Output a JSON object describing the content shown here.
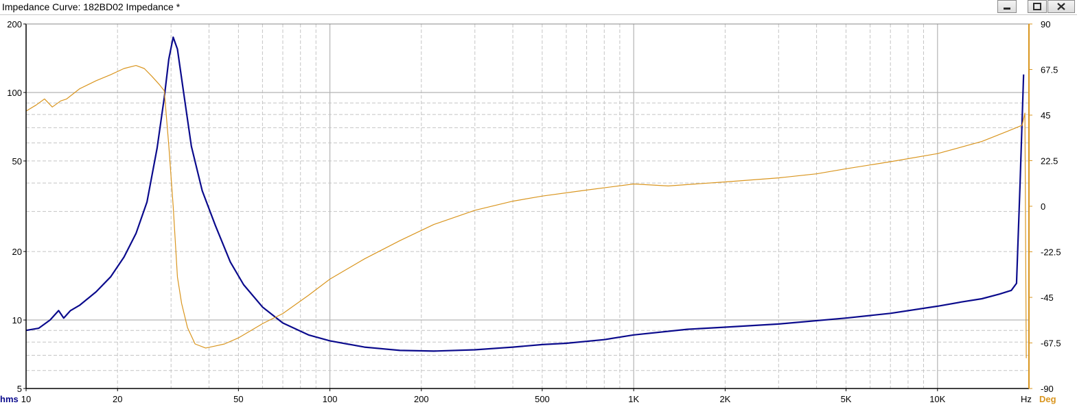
{
  "window": {
    "title": "Impedance Curve: 182BD02 Impedance *",
    "buttons": {
      "minimize": "minimize-icon",
      "maximize": "maximize-icon",
      "close": "close-icon"
    }
  },
  "colors": {
    "impedance": "#0a0a8c",
    "phase": "#d9951e",
    "grid_major": "#b4b4b4",
    "grid_minor": "#c4c4c4"
  },
  "chart_data": {
    "type": "line",
    "x_scale": "log",
    "y_scale": "log",
    "xlim": [
      10,
      20000
    ],
    "ylim": [
      5,
      200
    ],
    "y2lim": [
      -90,
      90
    ],
    "x_unit": "Hz",
    "y_unit": "hms",
    "y2_unit": "Deg",
    "x_ticks": [
      {
        "value": 10,
        "label": "10"
      },
      {
        "value": 20,
        "label": "20"
      },
      {
        "value": 50,
        "label": "50"
      },
      {
        "value": 100,
        "label": "100"
      },
      {
        "value": 200,
        "label": "200"
      },
      {
        "value": 500,
        "label": "500"
      },
      {
        "value": 1000,
        "label": "1K"
      },
      {
        "value": 2000,
        "label": "2K"
      },
      {
        "value": 5000,
        "label": "5K"
      },
      {
        "value": 10000,
        "label": "10K"
      }
    ],
    "y_ticks": [
      {
        "value": 5,
        "label": "5"
      },
      {
        "value": 10,
        "label": "10"
      },
      {
        "value": 20,
        "label": "20"
      },
      {
        "value": 50,
        "label": "50"
      },
      {
        "value": 100,
        "label": "100"
      },
      {
        "value": 200,
        "label": "200"
      }
    ],
    "y2_ticks": [
      {
        "value": -90,
        "label": "-90"
      },
      {
        "value": -67.5,
        "label": "-67.5"
      },
      {
        "value": -45,
        "label": "-45"
      },
      {
        "value": -22.5,
        "label": "-22.5"
      },
      {
        "value": 0,
        "label": "0"
      },
      {
        "value": 22.5,
        "label": "22.5"
      },
      {
        "value": 45,
        "label": "45"
      },
      {
        "value": 67.5,
        "label": "67.5"
      },
      {
        "value": 90,
        "label": "90"
      }
    ],
    "grid": true,
    "series": [
      {
        "axis": "left",
        "color": "#0a0a8c",
        "x": [
          10,
          11,
          12,
          12.8,
          13.3,
          14,
          15,
          17,
          19,
          21,
          23,
          25,
          27,
          28.5,
          29.5,
          30.5,
          31.5,
          33,
          35,
          38,
          42,
          47,
          52,
          60,
          70,
          85,
          100,
          130,
          170,
          220,
          300,
          400,
          500,
          600,
          800,
          1000,
          1500,
          2000,
          3000,
          5000,
          7000,
          10000,
          12000,
          14000,
          16000,
          17500,
          18200,
          18700,
          19200
        ],
        "y": [
          9.0,
          9.2,
          10.0,
          11.0,
          10.2,
          11.0,
          11.6,
          13.3,
          15.5,
          18.9,
          24,
          33,
          57,
          95,
          140,
          175,
          155,
          100,
          58,
          37,
          26,
          18,
          14.3,
          11.4,
          9.7,
          8.6,
          8.1,
          7.6,
          7.35,
          7.3,
          7.4,
          7.6,
          7.8,
          7.9,
          8.2,
          8.6,
          9.1,
          9.3,
          9.6,
          10.2,
          10.7,
          11.5,
          12.0,
          12.4,
          13.0,
          13.5,
          14.5,
          40,
          120
        ]
      },
      {
        "axis": "right",
        "color": "#d9951e",
        "x": [
          10,
          10.8,
          11.5,
          12.2,
          13,
          13.6,
          15,
          17,
          19,
          21,
          23,
          24.5,
          26,
          27.5,
          28.5,
          29.5,
          30.5,
          31.5,
          32.5,
          34,
          36,
          39,
          42,
          45,
          50,
          60,
          70,
          85,
          100,
          130,
          170,
          220,
          300,
          400,
          500,
          700,
          1000,
          1300,
          1600,
          2000,
          3000,
          4000,
          5000,
          7000,
          10000,
          14000,
          17000,
          19000,
          19400,
          19600
        ],
        "y": [
          47,
          50,
          53,
          49,
          52,
          53,
          58,
          62,
          65,
          68,
          69.5,
          68,
          64,
          60,
          57,
          30,
          0,
          -35,
          -48,
          -60,
          -68,
          -70,
          -69,
          -68,
          -65,
          -58,
          -53,
          -44,
          -36,
          -26,
          -17,
          -9,
          -2,
          2.5,
          5,
          8,
          11,
          10,
          11,
          12,
          14,
          16,
          18.5,
          22,
          26,
          32,
          37,
          40,
          46,
          -75
        ]
      }
    ]
  }
}
